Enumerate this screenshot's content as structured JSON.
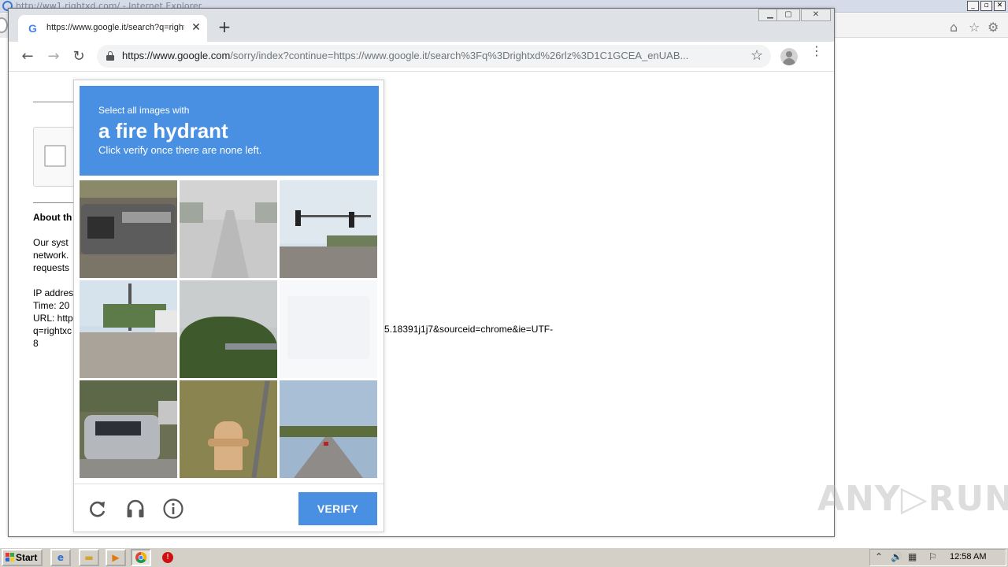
{
  "ie_window": {
    "title": "http://ww1.rightxd.com/ - Internet Explorer",
    "controls": {
      "minimize": "_",
      "restore": "▫",
      "close": "✕"
    },
    "toolbar_icons": [
      "home-icon",
      "favorites-star-icon",
      "settings-gear-icon"
    ]
  },
  "chrome": {
    "tab": {
      "favicon": "G",
      "title": "https://www.google.it/search?q=rightxd",
      "close": "✕"
    },
    "new_tab": "+",
    "window_controls": {
      "minimize": "▁",
      "maximize": "▢",
      "close": "✕"
    },
    "nav": {
      "back": "←",
      "forward": "→",
      "reload": "↻"
    },
    "address": {
      "host": "https://www.google.com",
      "path": "/sorry/index?continue=https://www.google.it/search%3Fq%3Drightxd%26rlz%3D1C1GCEA_enUAB..."
    },
    "bookmark_star": "☆",
    "menu": "⋮"
  },
  "page": {
    "about_heading": "About th",
    "body_lines": [
      "Our syst",
      "network.",
      "requests"
    ],
    "info_lines": [
      "IP addres",
      "Time: 20",
      "URL: http",
      "q=rightxc",
      "8"
    ],
    "url_tail": "5.18391j1j7&sourceid=chrome&ie=UTF-"
  },
  "captcha": {
    "instruction_small": "Select all images with",
    "instruction_target": "a fire hydrant",
    "instruction_sub": "Click verify once there are none left.",
    "tiles": [
      {
        "name": "tile-pickup-truck",
        "faded": false
      },
      {
        "name": "tile-foggy-road",
        "faded": false
      },
      {
        "name": "tile-traffic-light-street",
        "faded": false
      },
      {
        "name": "tile-power-lines-road",
        "faded": false
      },
      {
        "name": "tile-trees-bridge",
        "faded": false
      },
      {
        "name": "tile-fading-blank",
        "faded": true
      },
      {
        "name": "tile-parked-suv",
        "faded": false
      },
      {
        "name": "tile-fire-hydrant",
        "faded": false
      },
      {
        "name": "tile-highway",
        "faded": false
      }
    ],
    "verify_label": "VERIFY",
    "footer_icons": [
      "reload-icon",
      "audio-headphones-icon",
      "info-icon"
    ],
    "colors": {
      "header_blue": "#4a90e2",
      "button_blue": "#4a90e2"
    }
  },
  "watermark": "ANY▷RUN",
  "taskbar": {
    "start_label": "Start",
    "quick_launch": [
      "ie-icon",
      "folder-icon",
      "media-player-icon",
      "chrome-icon",
      "stop-icon"
    ],
    "tray_icons": [
      "expand-arrow-icon",
      "volume-icon",
      "network-icon",
      "flag-icon"
    ],
    "clock": "12:58 AM"
  }
}
